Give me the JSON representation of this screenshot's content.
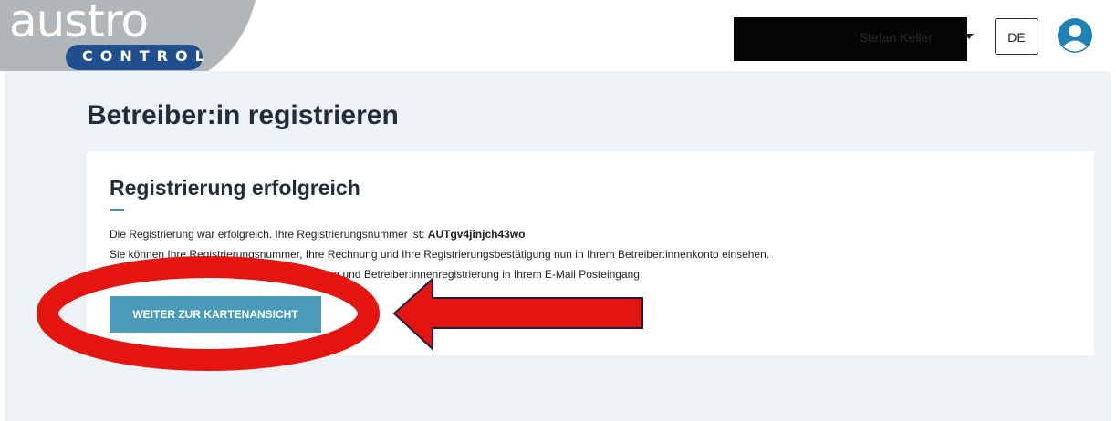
{
  "header": {
    "logo": {
      "main": "austro",
      "sub": "CONTROL"
    },
    "user": {
      "name": "Stefan Keller"
    },
    "language_button": "DE",
    "icons": {
      "user_caret": "caret-down-icon",
      "avatar": "user-circle-icon"
    }
  },
  "page": {
    "title": "Betreiber:in registrieren"
  },
  "card": {
    "title": "Registrierung erfolgreich",
    "line1_prefix": "Die Registrierung war erfolgreich. Ihre Registrierungsnummer ist: ",
    "registration_number": "AUTgv4jinjch43wo",
    "line2": "Sie können Ihre Registrierungsnummer, Ihre Rechnung und Ihre Registrierungsbestätigung nun in Ihrem Betreiber:innenkonto einsehen.",
    "line3": "Sie finden außerdem eine E-Mail mit Rechnung und Betreiber:innenregistrierung in Ihrem E-Mail Posteingang.",
    "button": "WEITER ZUR KARTENANSICHT"
  },
  "colors": {
    "brand_blue": "#1f4f8f",
    "accent": "#4196b6",
    "button": "#4a9bb9",
    "annotation_red": "#e4140f"
  }
}
